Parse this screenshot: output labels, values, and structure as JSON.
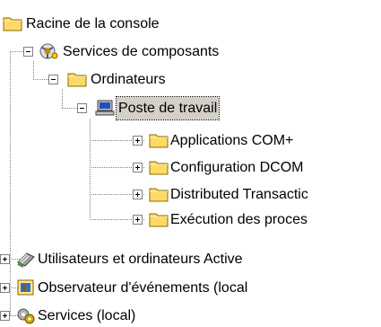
{
  "tree": {
    "root": {
      "label": "Racine de la console",
      "icon": "folder-icon"
    },
    "component_services": {
      "label": "Services de composants",
      "icon": "component-services-icon",
      "expanded": true
    },
    "computers": {
      "label": "Ordinateurs",
      "icon": "folder-icon",
      "expanded": true
    },
    "my_computer": {
      "label": "Poste de travail",
      "icon": "computer-icon",
      "expanded": true,
      "selected": true
    },
    "children": [
      {
        "label": "Applications COM+",
        "icon": "folder-icon",
        "expanded": false
      },
      {
        "label": "Configuration DCOM",
        "icon": "folder-icon",
        "expanded": false
      },
      {
        "label": "Distributed Transactic",
        "icon": "folder-icon",
        "expanded": false
      },
      {
        "label": "Exécution des proces",
        "icon": "folder-icon",
        "expanded": false
      }
    ],
    "active_directory": {
      "label": "Utilisateurs et ordinateurs Active",
      "icon": "users-computers-icon",
      "expanded": false
    },
    "event_viewer": {
      "label": "Observateur d'événements (local",
      "icon": "event-viewer-icon",
      "expanded": false
    },
    "services": {
      "label": "Services (local)",
      "icon": "services-icon",
      "expanded": false
    }
  },
  "colors": {
    "folder": "#ffd966",
    "folder_dark": "#b08d00",
    "selection": "#d4d0c8",
    "tree_lines": "#808080"
  }
}
